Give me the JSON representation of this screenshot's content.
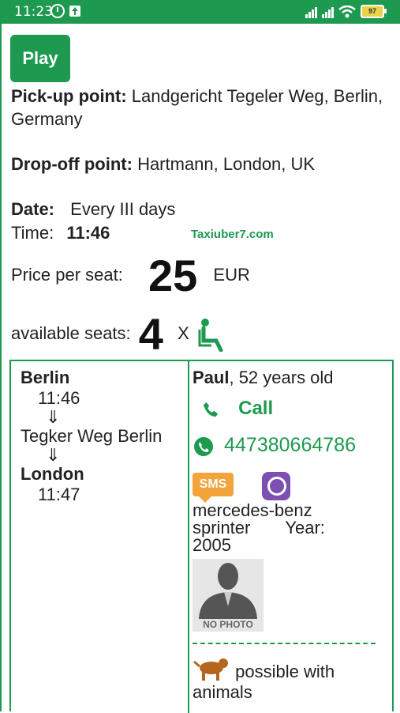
{
  "status_bar": {
    "time": "11:23",
    "battery": "97"
  },
  "play_button": "Play",
  "pickup": {
    "label": "Pick-up point:",
    "value": "Landgericht Tegeler Weg, Berlin, Germany"
  },
  "dropoff": {
    "label": "Drop-off point:",
    "value": "Hartmann, London, UK"
  },
  "date": {
    "label": "Date:",
    "value": "Every III days"
  },
  "time": {
    "label": "Time:",
    "value": "11:46"
  },
  "site": "Taxiuber7.com",
  "price": {
    "label": "Price per seat:",
    "value": "25",
    "currency": "EUR"
  },
  "seats": {
    "label": "available seats:",
    "value": "4",
    "x": "X"
  },
  "route": {
    "from_city": "Berlin",
    "from_time": "11:46",
    "arrow": "⇓",
    "stop": "Tegker Weg Berlin",
    "to_city": "London",
    "to_time": "11:47"
  },
  "driver": {
    "name": "Paul",
    "age_text": ", 52 years old",
    "call_label": "Call",
    "whatsapp_number": "447380664786",
    "sms_label": "SMS",
    "vehicle_line1": "mercedes-benz",
    "vehicle_line2": "sprinter",
    "year_label": "Year:",
    "year": "2005",
    "photo_label": "NO PHOTO",
    "animals_text": "possible with animals"
  },
  "colors": {
    "accent": "#1d9a4f",
    "sms": "#f2a33a",
    "viber": "#7d4fb3"
  }
}
